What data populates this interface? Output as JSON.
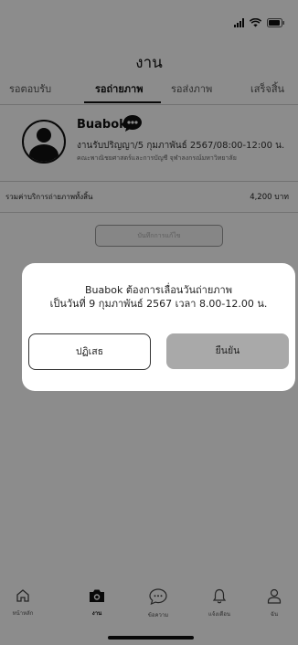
{
  "header": {
    "title": "งาน"
  },
  "tabs": [
    {
      "label": "รอตอบรับ"
    },
    {
      "label": "รอถ่ายภาพ"
    },
    {
      "label": "รอส่งภาพ"
    },
    {
      "label": "เสร็จสิ้น"
    }
  ],
  "active_tab": "รอถ่ายภาพ",
  "job": {
    "name": "Buabok",
    "detail": "งานรับปริญญา/5 กุมภาพันธ์ 2567/08:00-12:00 น.",
    "place": "คณะพาณิชยศาสตร์และการบัญชี จุฬาลงกรณ์มหาวิทยาลัย"
  },
  "summary": {
    "total_label": "รวมค่าบริการถ่ายภาพทั้งสิ้น",
    "total_value": "4,200 บาท"
  },
  "save_button": "บันทึกการแก้ไข",
  "modal": {
    "line1": "Buabok ต้องการเลื่อนวันถ่ายภาพ",
    "line2": "เป็นวันที่ 9 กุมภาพันธ์ 2567 เวลา 8.00-12.00 น.",
    "reject": "ปฏิเสธ",
    "confirm": "ยืนยัน"
  },
  "nav": [
    {
      "label": "หน้าหลัก",
      "icon": "home-icon"
    },
    {
      "label": "งาน",
      "icon": "camera-icon"
    },
    {
      "label": "ข้อความ",
      "icon": "chat-icon"
    },
    {
      "label": "แจ้งเตือน",
      "icon": "bell-icon"
    },
    {
      "label": "ฉัน",
      "icon": "user-icon"
    }
  ],
  "colors": {
    "accent": "#111111",
    "overlay": "#000000",
    "confirm_bg": "#a9a9a9"
  }
}
